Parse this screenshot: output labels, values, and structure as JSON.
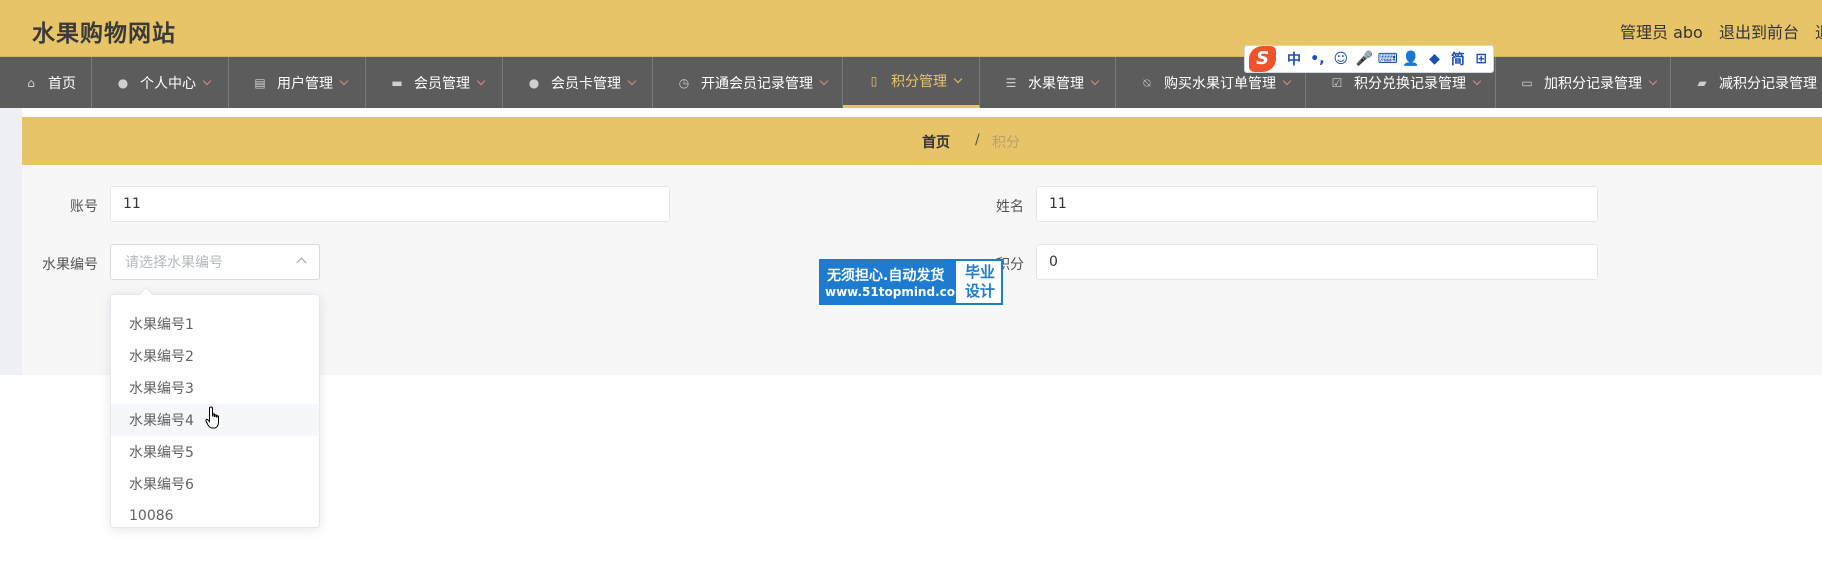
{
  "header": {
    "site_title": "水果购物网站",
    "admin_label": "管理员 abo",
    "exit_front_label": "退出到前台",
    "exit_cut_label": "退"
  },
  "nav": {
    "items": [
      {
        "label": "首页",
        "icon": "home-icon",
        "has_caret": false
      },
      {
        "label": "个人中心",
        "icon": "user-icon",
        "has_caret": true
      },
      {
        "label": "用户管理",
        "icon": "chart-icon",
        "has_caret": true
      },
      {
        "label": "会员管理",
        "icon": "chat-icon",
        "has_caret": true
      },
      {
        "label": "会员卡管理",
        "icon": "user-icon",
        "has_caret": true
      },
      {
        "label": "开通会员记录管理",
        "icon": "clock-icon",
        "has_caret": true
      },
      {
        "label": "积分管理",
        "icon": "tag-icon",
        "has_caret": true,
        "active": true
      },
      {
        "label": "水果管理",
        "icon": "sliders-icon",
        "has_caret": true
      },
      {
        "label": "购买水果订单管理",
        "icon": "bell-off-icon",
        "has_caret": true
      },
      {
        "label": "积分兑换记录管理",
        "icon": "checklist-icon",
        "has_caret": true
      },
      {
        "label": "加积分记录管理",
        "icon": "monitor-icon",
        "has_caret": true
      },
      {
        "label": "减积分记录管理",
        "icon": "camera-icon",
        "has_caret": false
      }
    ]
  },
  "ime": {
    "logo": "S",
    "items": [
      "中",
      "•,",
      "☺",
      "🎤",
      "⌨",
      "👤",
      "◆",
      "简",
      "⊞"
    ]
  },
  "breadcrumb": {
    "home": "首页",
    "separator": "/",
    "current": "积分"
  },
  "form": {
    "account_label": "账号",
    "account_value": "11",
    "name_label": "姓名",
    "name_value": "11",
    "fruit_no_label": "水果编号",
    "fruit_no_placeholder": "请选择水果编号",
    "points_label": "积分",
    "points_value": "0"
  },
  "dropdown": {
    "options": [
      "水果编号1",
      "水果编号2",
      "水果编号3",
      "水果编号4",
      "水果编号5",
      "水果编号6",
      "10086"
    ],
    "hovered_index": 3
  },
  "watermark": {
    "line1": "无须担心.自动发货",
    "line2": "www.51topmind.com",
    "right_top": "毕业",
    "right_bottom": "设计"
  },
  "colors": {
    "accent": "#e8c468",
    "nav_bg": "#5c5c5c",
    "watermark_blue": "#1d7ccf"
  }
}
